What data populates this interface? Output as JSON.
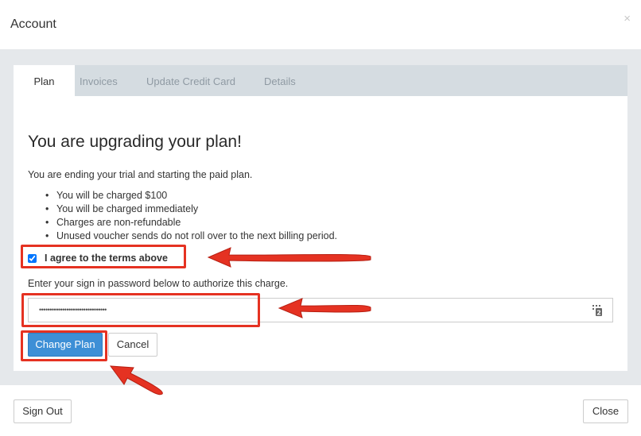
{
  "header": {
    "title": "Account",
    "close_symbol": "×"
  },
  "tabs": [
    {
      "label": "Plan",
      "active": true
    },
    {
      "label": "Invoices",
      "active": false
    },
    {
      "label": "Update Credit Card",
      "active": false
    },
    {
      "label": "Details",
      "active": false
    }
  ],
  "plan": {
    "heading": "You are upgrading your plan!",
    "intro": "You are ending your trial and starting the paid plan.",
    "bullets": [
      "You will be charged $100",
      "You will be charged immediately",
      "Charges are non-refundable",
      "Unused voucher sends do not roll over to the next billing period."
    ],
    "agree_label": "I agree to the terms above",
    "agree_checked": true,
    "password_label": "Enter your sign in password below to authorize this charge.",
    "password_value": "••••••••••••••••••••••••••••••••",
    "change_plan_label": "Change Plan",
    "cancel_label": "Cancel"
  },
  "footer": {
    "sign_out_label": "Sign Out",
    "close_label": "Close"
  },
  "colors": {
    "primary": "#3d8fd6",
    "annotation": "#e53222",
    "tabbar": "#d5dce1",
    "body_bg": "#e5e8eb"
  },
  "icons": {
    "password_manager": "password-manager-icon"
  }
}
